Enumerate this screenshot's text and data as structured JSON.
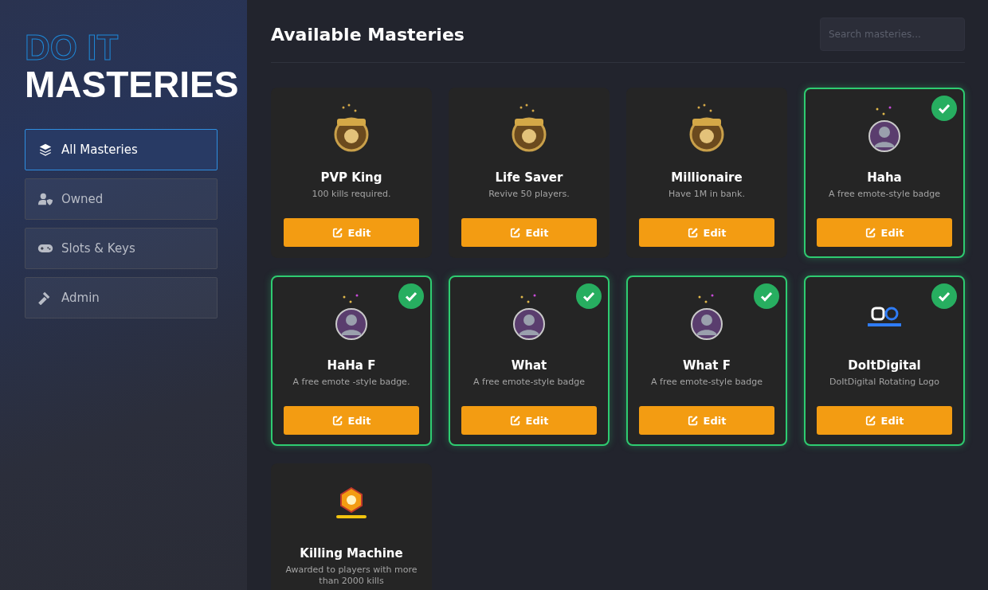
{
  "sidebar": {
    "logo_top": "DO IT",
    "logo_bottom": "MASTERIES",
    "items": [
      {
        "label": "All Masteries",
        "selected": true
      },
      {
        "label": "Owned",
        "selected": false
      },
      {
        "label": "Slots & Keys",
        "selected": false
      },
      {
        "label": "Admin",
        "selected": false
      }
    ]
  },
  "header": {
    "title": "Available Masteries",
    "search": {
      "placeholder": "Search masteries..."
    }
  },
  "masteries": [
    {
      "name": "PVP King",
      "description": "100 kills required.",
      "kind": "emblem",
      "owned": false,
      "button": "Edit"
    },
    {
      "name": "Life Saver",
      "description": "Revive 50 players.",
      "kind": "emblem",
      "owned": false,
      "button": "Edit"
    },
    {
      "name": "Millionaire",
      "description": "Have 1M in bank.",
      "kind": "emblem",
      "owned": false,
      "button": "Edit"
    },
    {
      "name": "Haha",
      "description": "A free emote-style badge",
      "kind": "avatar",
      "owned": true,
      "button": "Edit"
    },
    {
      "name": "HaHa F",
      "description": "A free emote -style badge.",
      "kind": "avatar",
      "owned": true,
      "button": "Edit"
    },
    {
      "name": "What",
      "description": "A free emote-style badge",
      "kind": "avatar",
      "owned": true,
      "button": "Edit"
    },
    {
      "name": "What F",
      "description": "A free emote-style badge",
      "kind": "avatar",
      "owned": true,
      "button": "Edit"
    },
    {
      "name": "DoItDigital",
      "description": "DoItDigital Rotating Logo",
      "kind": "logo",
      "owned": true,
      "button": "Edit"
    },
    {
      "name": "Killing Machine",
      "description": "Awarded to players with more than 2000 kills",
      "kind": "medal",
      "owned": false
    }
  ]
}
